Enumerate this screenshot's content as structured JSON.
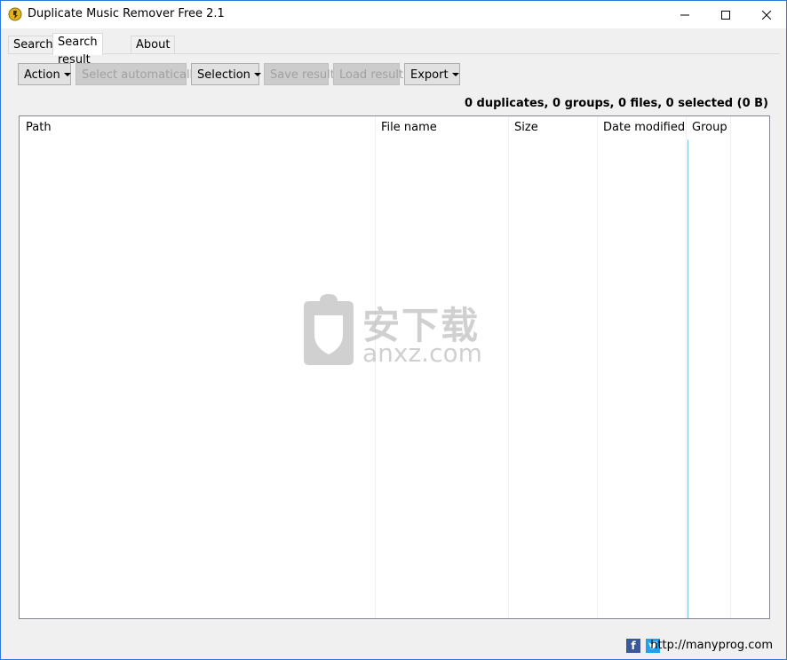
{
  "window": {
    "title": "Duplicate Music Remover Free 2.1",
    "controls": [
      "minimize-icon",
      "maximize-icon",
      "close-icon"
    ]
  },
  "tabs": [
    {
      "label": "Search"
    },
    {
      "label": "Search result"
    },
    {
      "label": "About"
    }
  ],
  "toolbar": {
    "action_label": "Action",
    "select_auto_label": "Select automatically",
    "selection_label": "Selection",
    "save_label": "Save result",
    "load_label": "Load result",
    "export_label": "Export"
  },
  "summary": "0 duplicates, 0 groups, 0 files, 0 selected (0 B)",
  "table": {
    "columns": [
      "Path",
      "File name",
      "Size",
      "Date modified",
      "Group"
    ]
  },
  "watermark": {
    "chinese": "安下载",
    "domain": "anxz.com"
  },
  "footer": {
    "link": "http://manyprog.com",
    "icons": [
      "facebook-icon",
      "twitter-icon"
    ]
  },
  "colors": {
    "title_bar": "#ffffff",
    "window_border": "#2b79d8",
    "background": "#f0f0f0",
    "grid_border": "#828790"
  }
}
